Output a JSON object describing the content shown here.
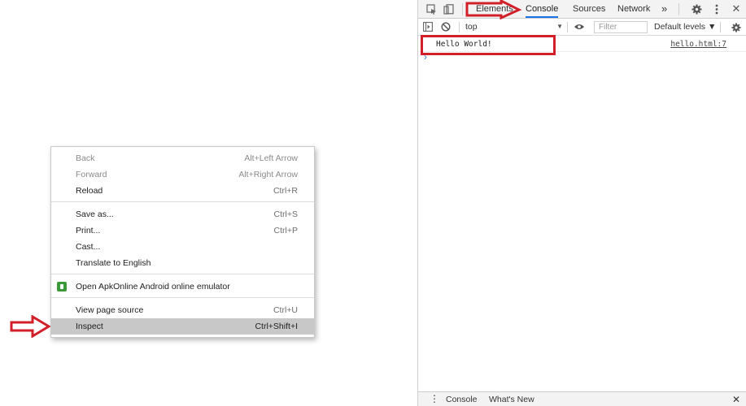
{
  "context_menu": {
    "items": [
      {
        "label": "Back",
        "shortcut": "Alt+Left Arrow"
      },
      {
        "label": "Forward",
        "shortcut": "Alt+Right Arrow"
      },
      {
        "label": "Reload",
        "shortcut": "Ctrl+R"
      },
      {
        "label": "Save as...",
        "shortcut": "Ctrl+S"
      },
      {
        "label": "Print...",
        "shortcut": "Ctrl+P"
      },
      {
        "label": "Cast...",
        "shortcut": ""
      },
      {
        "label": "Translate to English",
        "shortcut": ""
      },
      {
        "label": "Open ApkOnline Android online emulator",
        "shortcut": ""
      },
      {
        "label": "View page source",
        "shortcut": "Ctrl+U"
      },
      {
        "label": "Inspect",
        "shortcut": "Ctrl+Shift+I"
      }
    ]
  },
  "devtools": {
    "tabs": [
      "Elements",
      "Console",
      "Sources",
      "Network"
    ],
    "more_tabs": "»",
    "context": "top",
    "filter_placeholder": "Filter",
    "levels": "Default levels ▼",
    "console_message": "Hello World!",
    "console_source": "hello.html:7",
    "prompt": "›",
    "drawer_tabs": [
      "Console",
      "What's New"
    ],
    "drawer_menu": "⋮",
    "close": "✕"
  },
  "colors": {
    "annotation_red": "#d1202a",
    "active_tab_underline": "#1a73e8",
    "menu_highlight": "#c8c8c8"
  }
}
